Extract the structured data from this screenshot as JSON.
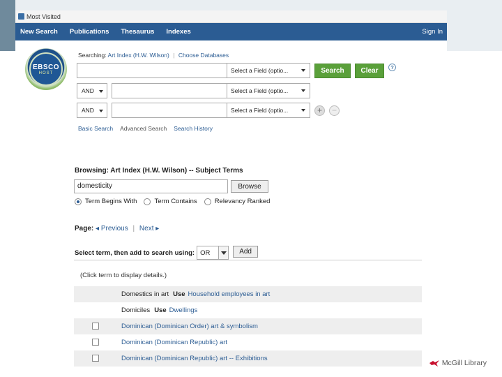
{
  "browser": {
    "most_visited": "Most Visited"
  },
  "nav": {
    "items": [
      "New Search",
      "Publications",
      "Thesaurus",
      "Indexes"
    ],
    "sign_in": "Sign In"
  },
  "logo": {
    "line1": "EBSCO",
    "line2": "HOST"
  },
  "searching": {
    "prefix": "Searching:",
    "database": "Art Index (H.W. Wilson)",
    "choose": "Choose Databases"
  },
  "search_rows": [
    {
      "bool": "",
      "field": "Select a Field (optio..."
    },
    {
      "bool": "AND",
      "field": "Select a Field (optio..."
    },
    {
      "bool": "AND",
      "field": "Select a Field (optio..."
    }
  ],
  "buttons": {
    "search": "Search",
    "clear": "Clear",
    "help": "?",
    "add_row": "+",
    "remove_row": "−"
  },
  "search_links": [
    "Basic Search",
    "Advanced Search",
    "Search History"
  ],
  "browse": {
    "title": "Browsing: Art Index (H.W. Wilson) -- Subject Terms",
    "input_value": "domesticity",
    "button": "Browse",
    "options": [
      "Term Begins With",
      "Term Contains",
      "Relevancy Ranked"
    ],
    "selected_option": "Term Begins With"
  },
  "pager": {
    "label": "Page:",
    "previous": "◂ Previous",
    "next": "Next ▸"
  },
  "select_term": {
    "label": "Select term, then add to search using:",
    "operator": "OR",
    "add": "Add"
  },
  "hint": "(Click term to display details.)",
  "terms": [
    {
      "term": "Domestics in art",
      "use": "Use",
      "target": "Household employees in art",
      "checkbox": false,
      "shaded": true
    },
    {
      "term": "Domiciles",
      "use": "Use",
      "target": "Dwellings",
      "checkbox": false,
      "shaded": false
    },
    {
      "term": "Dominican (Dominican Order) art & symbolism",
      "use": "",
      "target": "",
      "checkbox": true,
      "shaded": true
    },
    {
      "term": "Dominican (Dominican Republic) art",
      "use": "",
      "target": "",
      "checkbox": true,
      "shaded": false
    },
    {
      "term": "Dominican (Dominican Republic) art -- Exhibitions",
      "use": "",
      "target": "",
      "checkbox": true,
      "shaded": true
    }
  ],
  "footer": {
    "brand": "McGill Library",
    "icon": "martlet-bird-icon",
    "accent": "#c8102e"
  }
}
